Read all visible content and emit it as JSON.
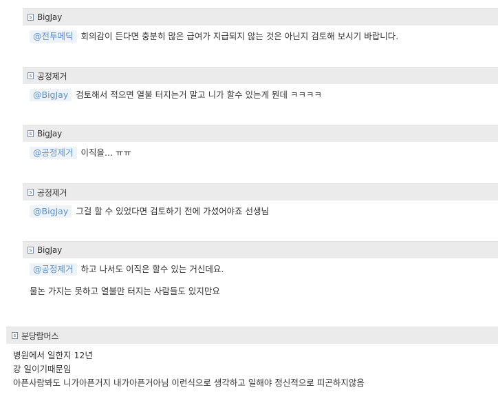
{
  "replies": [
    {
      "author": "BigJay",
      "mention": "@전투메딕",
      "text": "회의감이 든다면 충분히 많은 급여가 지급되지 않는 것은 아닌지 검토해 보시기 바랍니다.",
      "extra": ""
    },
    {
      "author": "공정제거",
      "mention": "@BigJay",
      "text": "검토해서 적으면 열불 터지는거 말고 니가 할수 있는게 뭔데 ㅋㅋㅋㅋ",
      "extra": ""
    },
    {
      "author": "BigJay",
      "mention": "@공정제거",
      "text": "이직을... ㅠㅠ",
      "extra": ""
    },
    {
      "author": "공정제거",
      "mention": "@BigJay",
      "text": "그걸 할 수 있었다면 검토하기 전에 가셨어야죠 선생님",
      "extra": ""
    },
    {
      "author": "BigJay",
      "mention": "@공정제거",
      "text": "하고 나서도 이직은 할수 있는 거신데요.",
      "extra": "물논 가지는 못하고 열불만 터지는 사람들도 있지만요"
    }
  ],
  "comment": {
    "author": "분당람머스",
    "lines": [
      "병원에서 일한지 12년",
      "강 일이기때문임",
      "아픈사람봐도 니가아픈거지 내가아픈거아님 이런식으로 생각하고 일해야 정신적으로 피곤하지않음"
    ]
  },
  "icons": {
    "badge": "member-badge-icon"
  },
  "colors": {
    "header_bg": "#ebebeb",
    "mention_text": "#5b8fc9",
    "mention_bg": "#eef3f8"
  }
}
